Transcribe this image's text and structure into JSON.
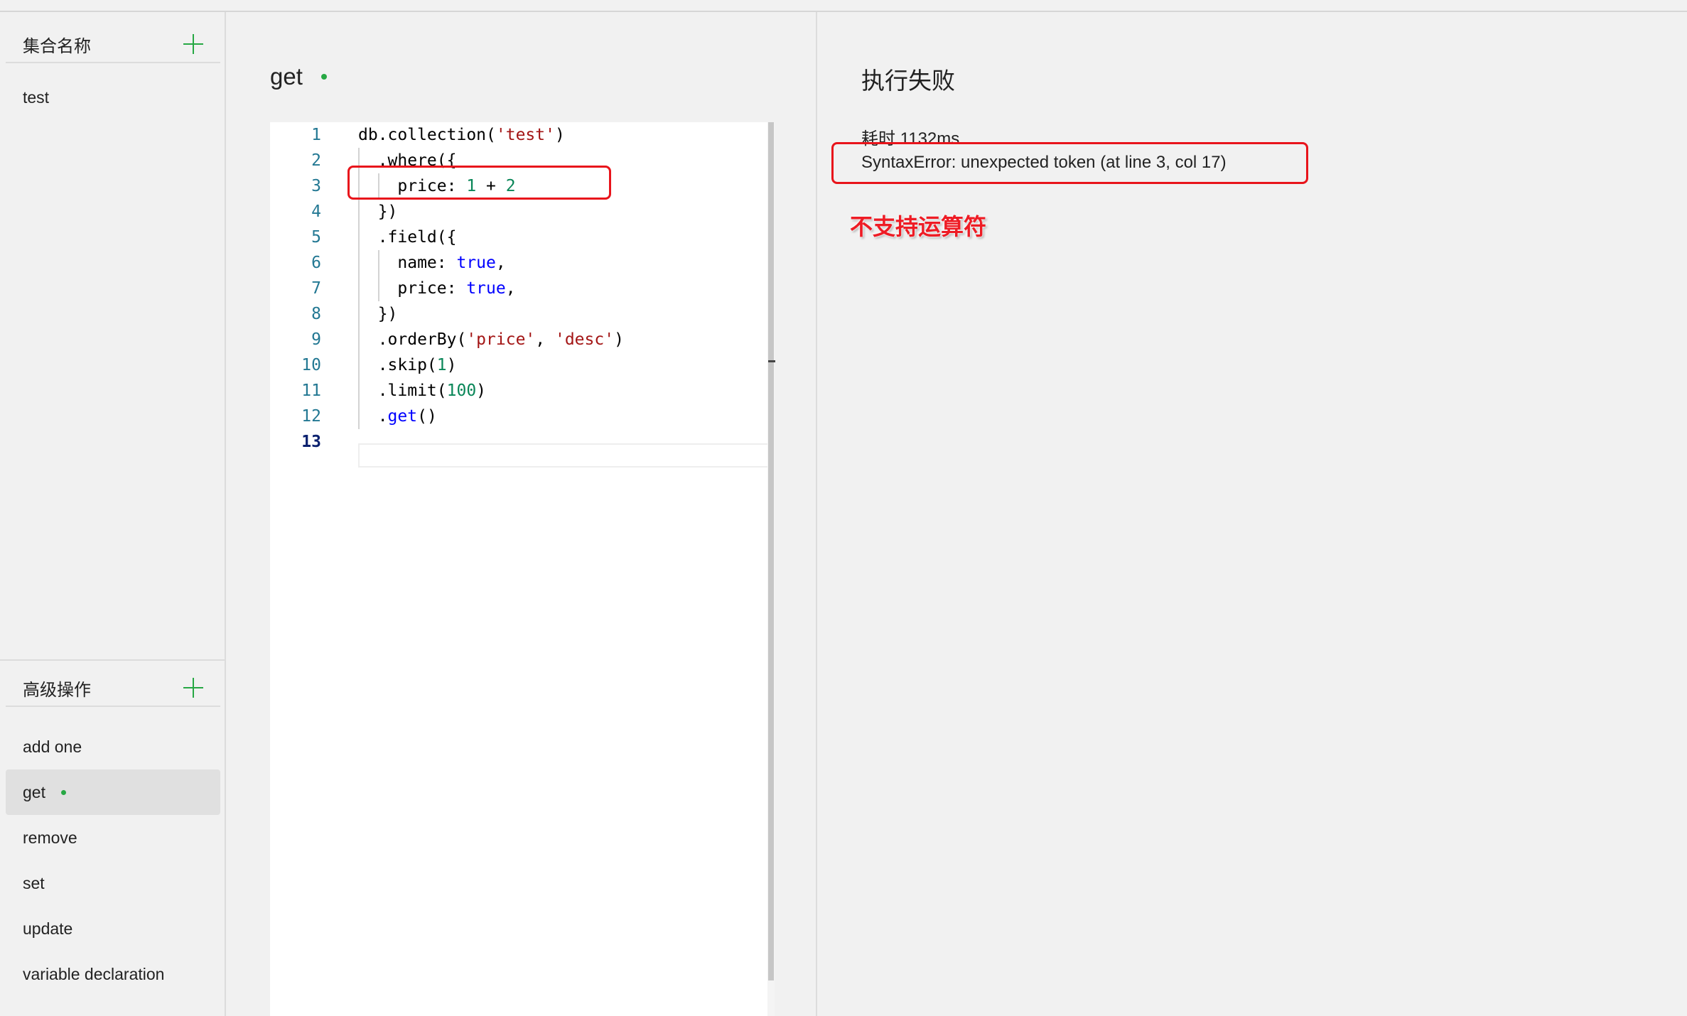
{
  "sidebar": {
    "collections_header": "集合名称",
    "collections": [
      {
        "label": "test"
      }
    ],
    "advanced_header": "高级操作",
    "advanced_items": [
      {
        "label": "add one"
      },
      {
        "label": "get",
        "active": true
      },
      {
        "label": "remove"
      },
      {
        "label": "set"
      },
      {
        "label": "update"
      },
      {
        "label": "variable declaration"
      }
    ]
  },
  "editor": {
    "title": "get",
    "line_numbers": [
      "1",
      "2",
      "3",
      "4",
      "5",
      "6",
      "7",
      "8",
      "9",
      "10",
      "11",
      "12",
      "13"
    ],
    "code_lines": [
      "db.collection('test')",
      "  .where({",
      "    price: 1 + 2",
      "  })",
      "  .field({",
      "    name: true,",
      "    price: true,",
      "  })",
      "  .orderBy('price', 'desc')",
      "  .skip(1)",
      "  .limit(100)",
      "  .get()",
      ""
    ]
  },
  "result": {
    "title": "执行失败",
    "time": "耗时 1132ms",
    "error": "SyntaxError: unexpected token (at line 3, col 17)"
  },
  "annotation": {
    "text": "不支持运算符",
    "color": "#ee1c25"
  },
  "colors": {
    "accent_green": "#27a844",
    "annotation_red": "#e8141b"
  }
}
